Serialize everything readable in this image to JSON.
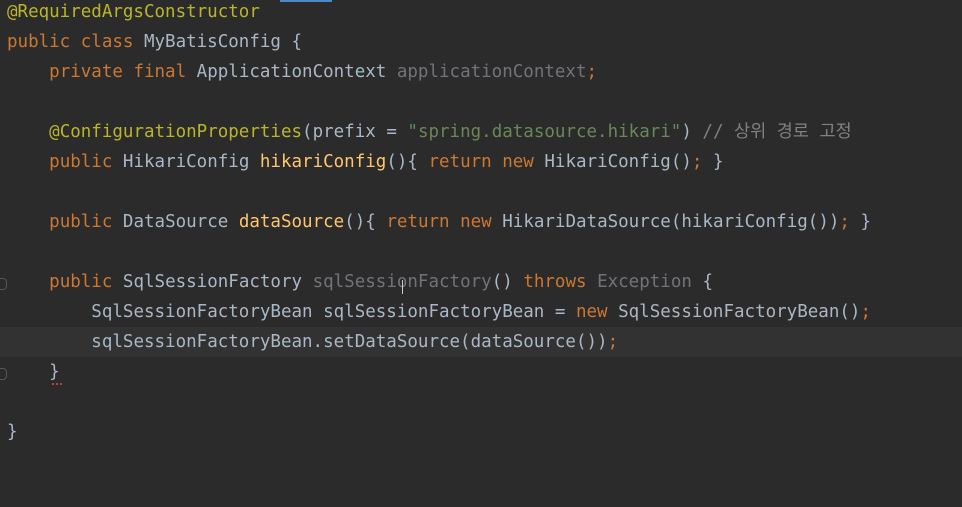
{
  "lines": {
    "l1": {
      "annotation": "@RequiredArgsConstructor"
    },
    "l2": {
      "kw": "public class ",
      "name": "MyBatisConfig",
      "rest": " {"
    },
    "l3": {
      "indent": "    ",
      "kw": "private final ",
      "type": "ApplicationContext ",
      "field": "applicationContext",
      "semi": ";"
    },
    "l4": {},
    "l5": {
      "indent": "    ",
      "annotation": "@ConfigurationProperties",
      "open": "(",
      "param": "prefix",
      "eq": " = ",
      "str": "\"spring.datasource.hikari\"",
      "close": ") ",
      "comment": "// 상위 경로 고정"
    },
    "l6": {
      "indent": "    ",
      "kw": "public ",
      "type": "HikariConfig ",
      "fn": "hikariConfig",
      "paren": "(){ ",
      "kw2": "return new ",
      "ctor": "HikariConfig()",
      "semi": ";",
      "end": " }"
    },
    "l7": {},
    "l8": {
      "indent": "    ",
      "kw": "public ",
      "type": "DataSource ",
      "fn": "dataSource",
      "paren": "(){ ",
      "kw2": "return new ",
      "ctor": "HikariDataSource(hikariConfig())",
      "semi": ";",
      "end": " }"
    },
    "l9": {},
    "l10": {
      "indent": "    ",
      "kw": "public ",
      "type": "SqlSessionFactory ",
      "fn": "sqlSessionFactory",
      "paren": "() ",
      "kw2": "throws ",
      "exc": "Exception",
      "end": " {"
    },
    "l11": {
      "indent": "        ",
      "text": "SqlSessionFactoryBean sqlSessionFactoryBean = ",
      "kw": "new ",
      "ctor": "SqlSessionFactoryBean()",
      "semi": ";"
    },
    "l12": {
      "indent": "        ",
      "text": "sqlSessionFactoryBean.setDataSource(dataSource())",
      "semi": ";"
    },
    "l13": {
      "indent": "    ",
      "text": "}"
    },
    "l14": {},
    "l15": {
      "text": "}"
    }
  },
  "colors": {
    "background": "#2b2b2b",
    "current_line": "#323232",
    "keyword": "#cc7832",
    "annotation": "#bbb529",
    "function": "#ffc66d",
    "string": "#6a8759",
    "comment": "#808080",
    "unused": "#72737a",
    "text": "#a9b7c6"
  }
}
